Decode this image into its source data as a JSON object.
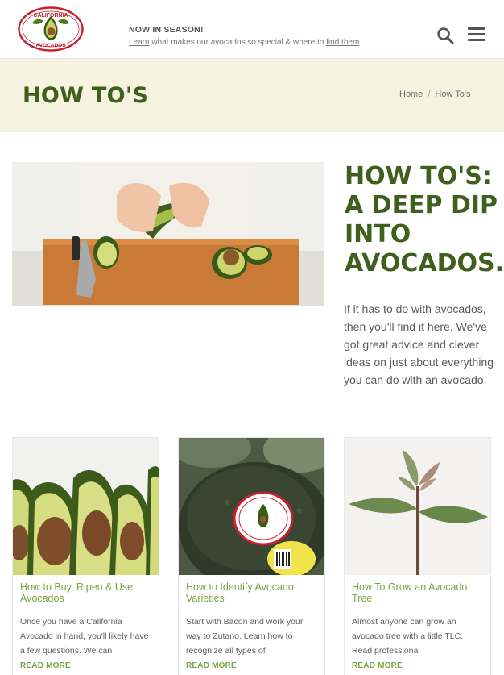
{
  "header": {
    "logo_text_top": "CALIFORNIA",
    "logo_text_bottom": "AVOCADOS",
    "season_title": "NOW IN SEASON!",
    "season_learn": "Learn",
    "season_middle": " what makes our avocados so special & where to ",
    "season_find": "find them",
    "search_icon": "search-icon",
    "menu_icon": "hamburger-menu-icon"
  },
  "banner": {
    "title": "HOW TO'S",
    "breadcrumb": {
      "home": "Home",
      "separator": "/",
      "current": "How To's"
    }
  },
  "hero": {
    "heading": "HOW TO'S: A DEEP DIP INTO AVOCADOS.",
    "body": "If it has to do with avocados, then you'll find it here. We've got great advice and clever ideas on just about everything you can do with an avocado."
  },
  "cards": [
    {
      "title": "How to Buy, Ripen & Use Avocados",
      "text": "Once you have a California Avocado in hand, you'll likely have a few questions. We can",
      "more": "READ MORE"
    },
    {
      "title": "How to Identify Avocado Varieties",
      "text": "Start with Bacon and work your way to Zutano. Learn how to recognize all types of",
      "more": "READ MORE"
    },
    {
      "title": "How To Grow an Avocado Tree",
      "text": "Almost anyone can grow an avocado tree with a little TLC. Read professional",
      "more": "READ MORE"
    }
  ],
  "colors": {
    "brand_green": "#3f5f1c",
    "link_green": "#79a548",
    "banner_bg": "#f6f3e1",
    "logo_red": "#c8202f"
  }
}
